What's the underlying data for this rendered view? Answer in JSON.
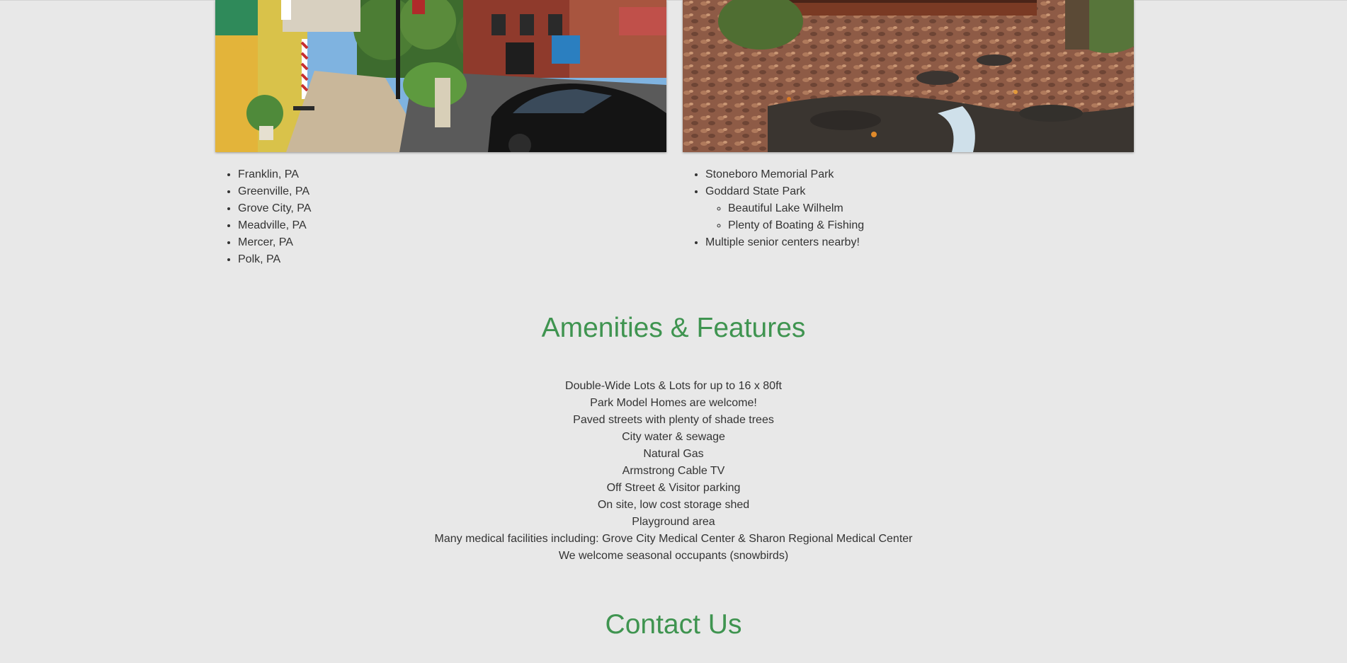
{
  "colors": {
    "background": "#e8e8e8",
    "heading_green": "#3f9450",
    "text": "#333333"
  },
  "left_column": {
    "image": "street-scene-photo",
    "towns": [
      "Franklin, PA",
      "Greenville, PA",
      "Grove City, PA",
      "Meadville, PA",
      "Mercer, PA",
      "Polk, PA"
    ]
  },
  "right_column": {
    "image": "creek-park-photo",
    "items": {
      "park1": "Stoneboro Memorial Park",
      "park2": "Goddard State Park",
      "park2_sub1": "Beautiful Lake Wilhelm",
      "park2_sub2": "Plenty of Boating & Fishing",
      "seniors": "Multiple senior centers nearby!"
    }
  },
  "amenities": {
    "title": "Amenities & Features",
    "items": [
      "Double-Wide Lots & Lots for up to 16 x 80ft",
      "Park Model Homes are welcome!",
      "Paved streets with plenty of shade trees",
      "City water & sewage",
      "Natural Gas",
      "Armstrong Cable TV",
      "Off Street & Visitor parking",
      "On site, low cost storage shed",
      "Playground area",
      "Many medical facilities including: Grove City Medical Center & Sharon Regional Medical Center",
      "We welcome seasonal occupants (snowbirds)"
    ]
  },
  "contact": {
    "title": "Contact Us"
  }
}
